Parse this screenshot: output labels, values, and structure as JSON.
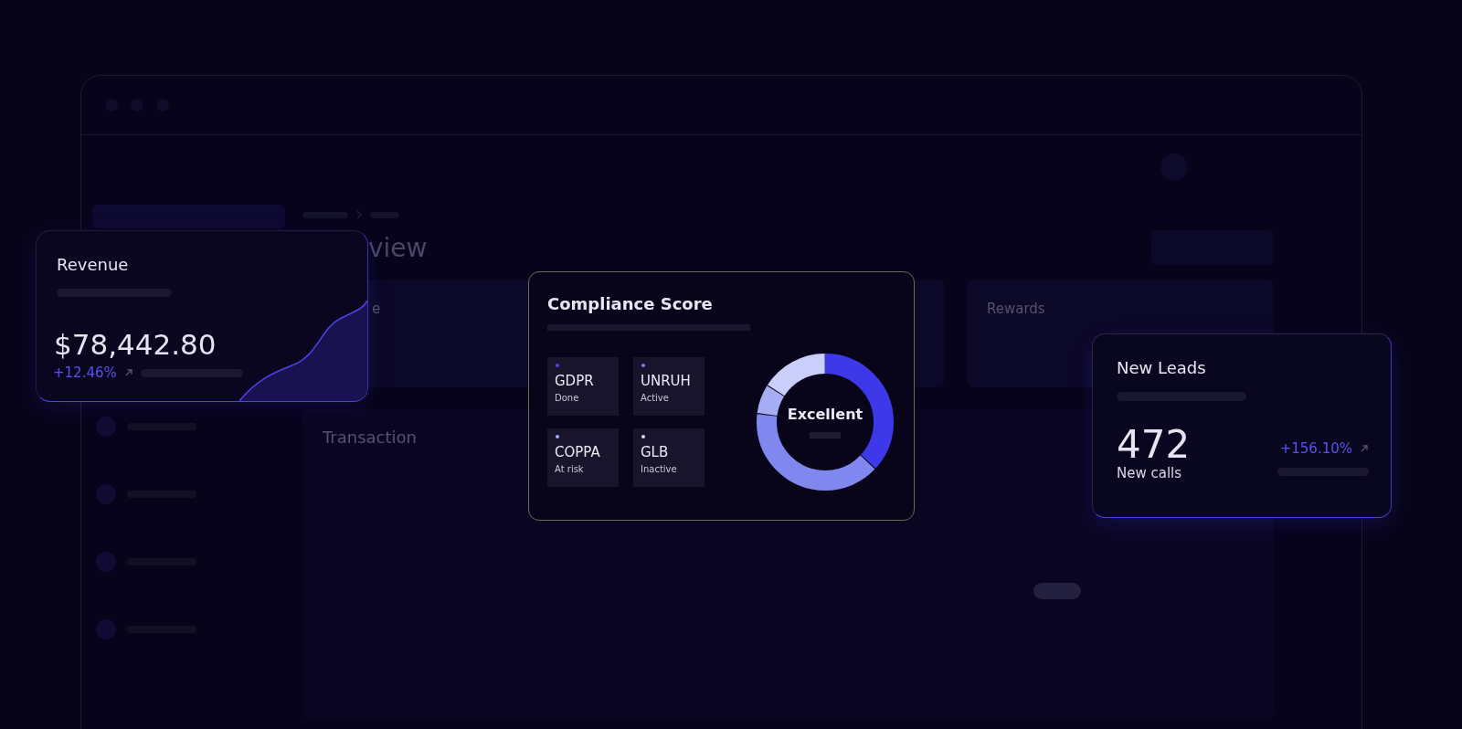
{
  "dashboard": {
    "title_fragment": "view",
    "card_fragment": "e",
    "rewards_label": "Rewards",
    "transaction_label": "Transaction"
  },
  "revenue_card": {
    "title": "Revenue",
    "amount": "$78,442.80",
    "change": "+12.46%"
  },
  "compliance_card": {
    "title": "Compliance Score",
    "center_label": "Excellent",
    "items": [
      {
        "name": "GDPR",
        "status": "Done",
        "color": "#4a44e8"
      },
      {
        "name": "UNRUH",
        "status": "Active",
        "color": "#7b80f0"
      },
      {
        "name": "COPPA",
        "status": "At risk",
        "color": "#a3a8f5"
      },
      {
        "name": "GLB",
        "status": "Inactive",
        "color": "#d2d5fa"
      }
    ]
  },
  "leads_card": {
    "title": "New Leads",
    "count": "472",
    "caption": "New calls",
    "change": "+156.10%"
  }
}
